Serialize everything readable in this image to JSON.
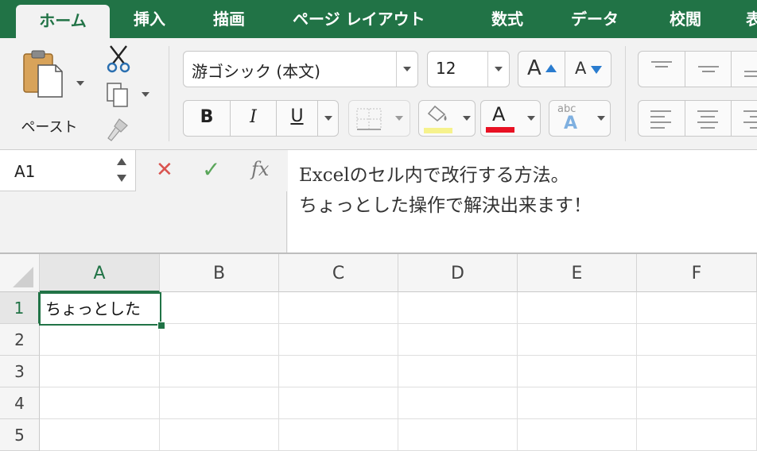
{
  "ribbon_tabs": [
    {
      "label": "ホーム",
      "active": true
    },
    {
      "label": "挿入"
    },
    {
      "label": "描画"
    },
    {
      "label": "ページ レイアウト"
    },
    {
      "label": "数式"
    },
    {
      "label": "データ"
    },
    {
      "label": "校閲"
    },
    {
      "label": "表"
    }
  ],
  "clipboard": {
    "paste_label": "ペースト"
  },
  "font": {
    "name": "游ゴシック (本文)",
    "size": "12",
    "grow_glyph": "A",
    "shrink_glyph": "A",
    "bold_glyph": "B",
    "italic_glyph": "I",
    "underline_glyph": "U",
    "font_color_glyph": "A",
    "phonetic_small": "abc",
    "phonetic_glyph": "A",
    "font_color": "#e81123",
    "highlight_color": "#f6f28d"
  },
  "formula_bar": {
    "name_box": "A1",
    "cancel_glyph": "✕",
    "enter_glyph": "✓",
    "fx_glyph": "fx",
    "lines": [
      "Excelのセル内で改行する方法。",
      "ちょっとした操作で解決出来ます！"
    ]
  },
  "grid": {
    "columns": [
      "A",
      "B",
      "C",
      "D",
      "E",
      "F"
    ],
    "rows": [
      "1",
      "2",
      "3",
      "4",
      "5"
    ],
    "active_cell_text": "ちょっとした",
    "accent_color": "#217346"
  }
}
